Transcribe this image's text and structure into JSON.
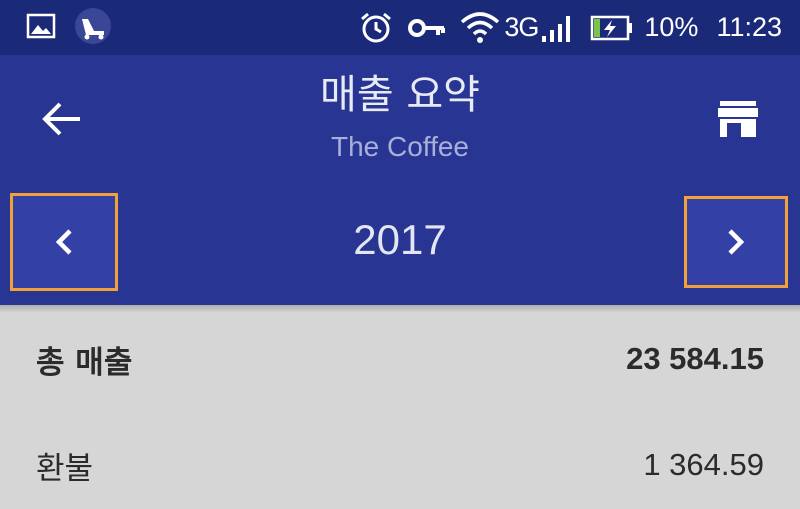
{
  "status_bar": {
    "icons_left": [
      "image-icon",
      "app-notification-icon"
    ],
    "network": "3G",
    "battery": "10%",
    "time": "11:23",
    "icons_right": [
      "alarm-icon",
      "key-icon",
      "wifi-icon",
      "signal-icon",
      "battery-icon"
    ]
  },
  "header": {
    "title": "매출 요약",
    "subtitle": "The Coffee"
  },
  "period": {
    "year": "2017"
  },
  "summary": {
    "total_label": "총 매출",
    "total_value": "23 584.15",
    "refund_label": "환불",
    "refund_value": "1 364.59"
  },
  "colors": {
    "status_bar": "#1a2a78",
    "app_bar": "#283593",
    "nav_button": "#3341a6",
    "highlight_border": "#f2a13a",
    "content_bg": "#d6d6d6"
  }
}
